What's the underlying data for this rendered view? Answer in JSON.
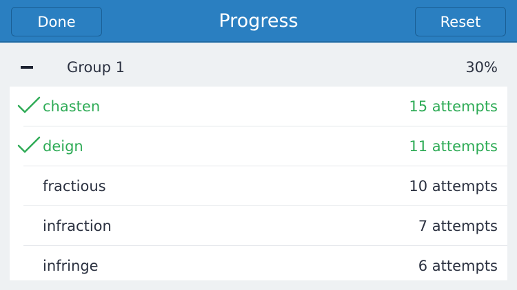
{
  "navbar": {
    "done_label": "Done",
    "title": "Progress",
    "reset_label": "Reset",
    "color": "#2a7fc1"
  },
  "group": {
    "title": "Group 1",
    "percent": "30%",
    "collapse_icon": "minus-icon",
    "items": [
      {
        "word": "chasten",
        "attempts": "15 attempts",
        "completed": true
      },
      {
        "word": "deign",
        "attempts": "11 attempts",
        "completed": true
      },
      {
        "word": "fractious",
        "attempts": "10 attempts",
        "completed": false
      },
      {
        "word": "infraction",
        "attempts": "7 attempts",
        "completed": false
      },
      {
        "word": "infringe",
        "attempts": "6 attempts",
        "completed": false
      }
    ]
  },
  "colors": {
    "completed": "#2eab56",
    "text": "#2b3140"
  }
}
